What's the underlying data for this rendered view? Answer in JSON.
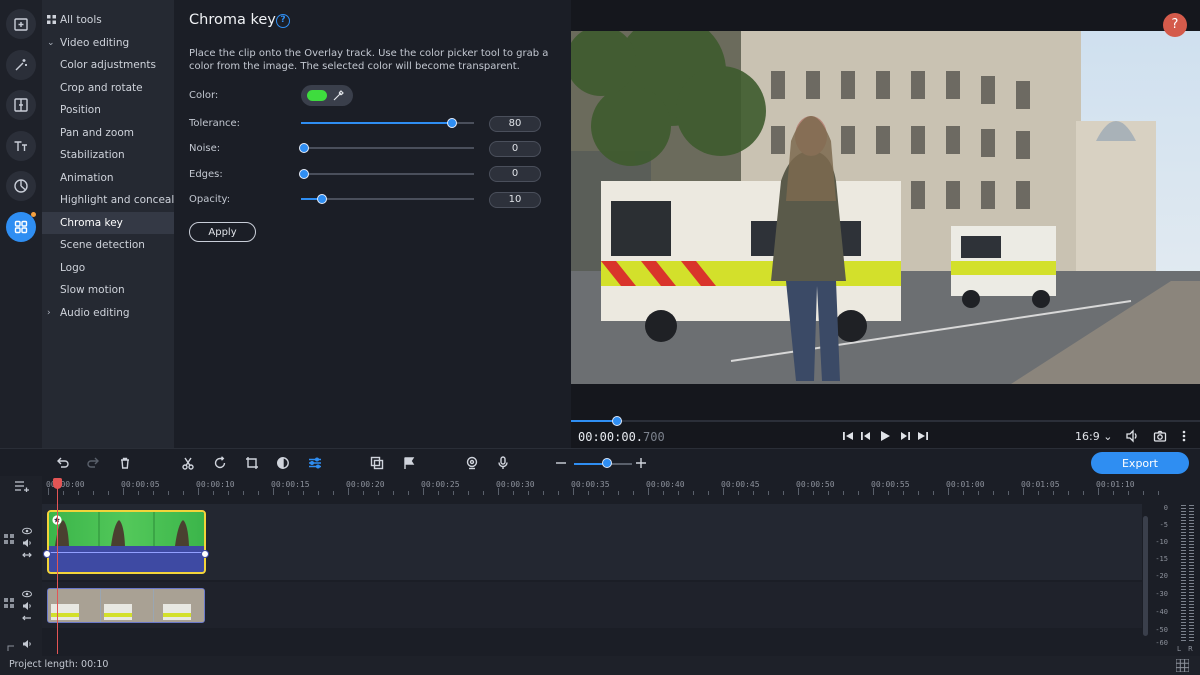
{
  "rail": {
    "items": [
      {
        "name": "import-files-icon"
      },
      {
        "name": "magic-wand-icon"
      },
      {
        "name": "transitions-icon"
      },
      {
        "name": "titles-icon"
      },
      {
        "name": "stickers-icon"
      },
      {
        "name": "more-tools-icon"
      }
    ]
  },
  "tools": {
    "all_tools": "All tools",
    "video_editing": "Video editing",
    "items": [
      "Color adjustments",
      "Crop and rotate",
      "Position",
      "Pan and zoom",
      "Stabilization",
      "Animation",
      "Highlight and conceal",
      "Chroma key",
      "Scene detection",
      "Logo",
      "Slow motion"
    ],
    "audio_editing": "Audio editing",
    "active_index": 7
  },
  "panel": {
    "title": "Chroma key",
    "help": "?",
    "description": "Place the clip onto the Overlay track. Use the color picker tool to grab a color from the image. The selected color will become transparent.",
    "color_label": "Color:",
    "selected_color": "#3edc3e",
    "tolerance_label": "Tolerance:",
    "tolerance_value": "80",
    "noise_label": "Noise:",
    "noise_value": "0",
    "edges_label": "Edges:",
    "edges_value": "0",
    "opacity_label": "Opacity:",
    "opacity_value": "10",
    "apply_label": "Apply"
  },
  "sliders": {
    "tolerance": 0.87,
    "noise": 0.0,
    "edges": 0.0,
    "opacity": 0.12
  },
  "preview": {
    "help_label": "?",
    "timecode_main": "00:00:00.",
    "timecode_ms": "700",
    "aspect_ratio": "16:9 ⌄",
    "position_fraction": 0.07
  },
  "toolbar": {
    "export_label": "Export",
    "zoom_fraction": 0.6
  },
  "timeline": {
    "ticks": [
      "00:00:00",
      "00:00:05",
      "00:00:10",
      "00:00:15",
      "00:00:20",
      "00:00:25",
      "00:00:30",
      "00:00:35",
      "00:00:40",
      "00:00:45",
      "00:00:50",
      "00:00:55",
      "00:01:00",
      "00:01:05",
      "00:01:10"
    ]
  },
  "meter": {
    "labels": [
      "0",
      "-5",
      "-10",
      "-15",
      "-20",
      "-30",
      "-40",
      "-50",
      "-60"
    ],
    "channels": [
      "L",
      "R"
    ]
  },
  "status": {
    "project_length": "Project length: 00:10"
  },
  "colors": {
    "accent": "#2f8ef2",
    "clip_border": "#f2d43a",
    "playhead": "#e35555"
  }
}
